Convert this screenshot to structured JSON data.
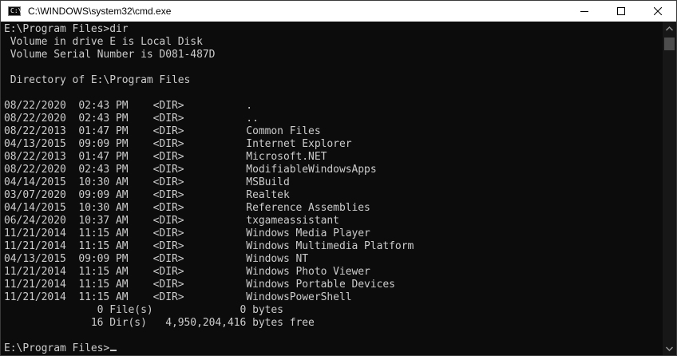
{
  "window": {
    "title": "C:\\WINDOWS\\system32\\cmd.exe",
    "icon": "cmd-icon",
    "icon_glyph": "C:\\"
  },
  "caption_buttons": {
    "minimize": "minimize-icon",
    "maximize": "maximize-icon",
    "close": "close-icon"
  },
  "console": {
    "background": "#0c0c0c",
    "foreground": "#cccccc",
    "command_line": "E:\\Program Files>dir",
    "volume_line": " Volume in drive E is Local Disk",
    "serial_line": " Volume Serial Number is D081-487D",
    "blank_1": "",
    "directory_line": " Directory of E:\\Program Files",
    "blank_2": "",
    "entries": [
      "08/22/2020  02:43 PM    <DIR>          .",
      "08/22/2020  02:43 PM    <DIR>          ..",
      "08/22/2013  01:47 PM    <DIR>          Common Files",
      "04/13/2015  09:09 PM    <DIR>          Internet Explorer",
      "08/22/2013  01:47 PM    <DIR>          Microsoft.NET",
      "08/22/2020  02:43 PM    <DIR>          ModifiableWindowsApps",
      "04/14/2015  10:30 AM    <DIR>          MSBuild",
      "03/07/2020  09:09 AM    <DIR>          Realtek",
      "04/14/2015  10:30 AM    <DIR>          Reference Assemblies",
      "06/24/2020  10:37 AM    <DIR>          txgameassistant",
      "11/21/2014  11:15 AM    <DIR>          Windows Media Player",
      "11/21/2014  11:15 AM    <DIR>          Windows Multimedia Platform",
      "04/13/2015  09:09 PM    <DIR>          Windows NT",
      "11/21/2014  11:15 AM    <DIR>          Windows Photo Viewer",
      "11/21/2014  11:15 AM    <DIR>          Windows Portable Devices",
      "11/21/2014  11:15 AM    <DIR>          WindowsPowerShell"
    ],
    "files_summary": "               0 File(s)              0 bytes",
    "dirs_summary": "              16 Dir(s)   4,950,204,416 bytes free",
    "blank_3": "",
    "prompt": "E:\\Program Files>"
  },
  "scrollbar": {
    "up_arrow": "scroll-up-arrow-icon",
    "down_arrow": "scroll-down-arrow-icon"
  }
}
